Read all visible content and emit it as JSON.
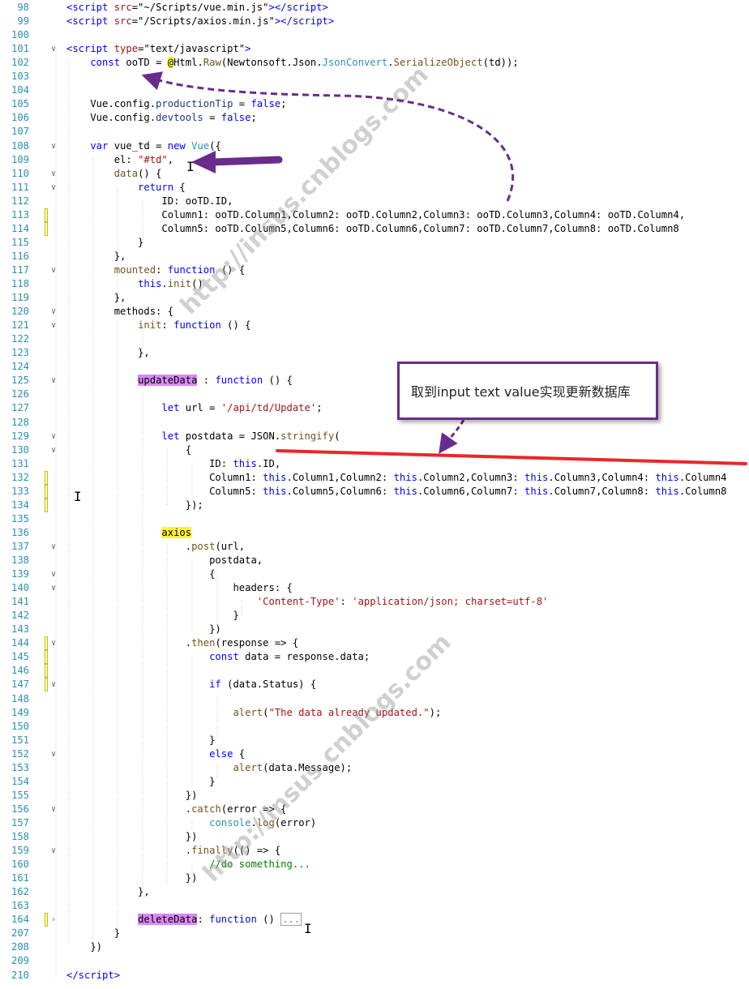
{
  "lines": [
    {
      "n": "98",
      "segs": [
        [
          "<script ",
          "kw"
        ],
        [
          "src",
          "str"
        ],
        [
          "=\"~/Scripts/vue.min.js\"",
          ""
        ],
        [
          "></script>",
          "kw"
        ]
      ]
    },
    {
      "n": "99",
      "segs": [
        [
          "<script ",
          "kw"
        ],
        [
          "src",
          "str"
        ],
        [
          "=\"/Scripts/axios.min.js\"",
          ""
        ],
        [
          "></script>",
          "kw"
        ]
      ]
    },
    {
      "n": "100",
      "segs": []
    },
    {
      "n": "101",
      "segs": [
        [
          "<script ",
          "kw"
        ],
        [
          "type",
          "str"
        ],
        [
          "=\"text/javascript\"",
          ""
        ],
        [
          ">",
          "kw"
        ]
      ]
    },
    {
      "n": "102",
      "segs": [
        [
          "    const ",
          "kw"
        ],
        [
          "ooTD",
          ""
        ],
        [
          " = ",
          ""
        ],
        [
          "@",
          "razor"
        ],
        [
          "Html.",
          ""
        ],
        [
          "Raw",
          "mth"
        ],
        [
          "(Newtonsoft.Json.",
          ""
        ],
        [
          "JsonConvert",
          "typ"
        ],
        [
          ".",
          ""
        ],
        [
          "SerializeObject",
          "mth"
        ],
        [
          "(td));",
          ""
        ]
      ]
    },
    {
      "n": "103",
      "segs": []
    },
    {
      "n": "104",
      "segs": []
    },
    {
      "n": "105",
      "segs": [
        [
          "    Vue.config.",
          ""
        ],
        [
          "productionTip",
          "prop"
        ],
        [
          " = ",
          ""
        ],
        [
          "false",
          "kw"
        ],
        [
          ";",
          ""
        ]
      ]
    },
    {
      "n": "106",
      "segs": [
        [
          "    Vue.config.",
          ""
        ],
        [
          "devtools",
          "prop"
        ],
        [
          " = ",
          ""
        ],
        [
          "false",
          "kw"
        ],
        [
          ";",
          ""
        ]
      ]
    },
    {
      "n": "107",
      "segs": []
    },
    {
      "n": "108",
      "segs": [
        [
          "    var ",
          "kw"
        ],
        [
          "vue_td = ",
          ""
        ],
        [
          "new ",
          "kw"
        ],
        [
          "Vue",
          "typ"
        ],
        [
          "({",
          ""
        ]
      ]
    },
    {
      "n": "109",
      "segs": [
        [
          "        el: ",
          ""
        ],
        [
          "\"#td\"",
          "str"
        ],
        [
          ",",
          ""
        ]
      ]
    },
    {
      "n": "110",
      "segs": [
        [
          "        ",
          ""
        ],
        [
          "data",
          "mth"
        ],
        [
          "() {",
          ""
        ]
      ]
    },
    {
      "n": "111",
      "segs": [
        [
          "            return ",
          "kw"
        ],
        [
          "{",
          ""
        ]
      ]
    },
    {
      "n": "112",
      "segs": [
        [
          "                ID: ooTD.ID,",
          ""
        ]
      ]
    },
    {
      "n": "113",
      "segs": [
        [
          "                Column1: ooTD.Column1,Column2: ooTD.Column2,Column3: ooTD.Column3,Column4: ooTD.Column4,",
          ""
        ]
      ]
    },
    {
      "n": "114",
      "segs": [
        [
          "                Column5: ooTD.Column5,Column6: ooTD.Column6,Column7: ooTD.Column7,Column8: ooTD.Column8",
          ""
        ]
      ]
    },
    {
      "n": "115",
      "segs": [
        [
          "            }",
          ""
        ]
      ]
    },
    {
      "n": "116",
      "segs": [
        [
          "        },",
          ""
        ]
      ]
    },
    {
      "n": "117",
      "segs": [
        [
          "        ",
          ""
        ],
        [
          "mounted",
          "mth"
        ],
        [
          ": ",
          ""
        ],
        [
          "function ",
          "kw"
        ],
        [
          "() {",
          ""
        ]
      ]
    },
    {
      "n": "118",
      "segs": [
        [
          "            ",
          ""
        ],
        [
          "this",
          "kw"
        ],
        [
          ".",
          ""
        ],
        [
          "init",
          "mth"
        ],
        [
          "()",
          ""
        ]
      ]
    },
    {
      "n": "119",
      "segs": [
        [
          "        },",
          ""
        ]
      ]
    },
    {
      "n": "120",
      "segs": [
        [
          "        methods: {",
          ""
        ]
      ]
    },
    {
      "n": "121",
      "segs": [
        [
          "            ",
          ""
        ],
        [
          "init",
          "mth"
        ],
        [
          ": ",
          ""
        ],
        [
          "function ",
          "kw"
        ],
        [
          "() {",
          ""
        ]
      ]
    },
    {
      "n": "122",
      "segs": []
    },
    {
      "n": "123",
      "segs": [
        [
          "            },",
          ""
        ]
      ]
    },
    {
      "n": "124",
      "segs": []
    },
    {
      "n": "125",
      "segs": [
        [
          "            ",
          ""
        ],
        [
          "updateData",
          "hl-purple"
        ],
        [
          " : ",
          ""
        ],
        [
          "function ",
          "kw"
        ],
        [
          "() {",
          ""
        ]
      ]
    },
    {
      "n": "126",
      "segs": []
    },
    {
      "n": "127",
      "segs": [
        [
          "                let ",
          "kw"
        ],
        [
          "url = ",
          ""
        ],
        [
          "'/api/td/Update'",
          "str"
        ],
        [
          ";",
          ""
        ]
      ]
    },
    {
      "n": "128",
      "segs": []
    },
    {
      "n": "129",
      "segs": [
        [
          "                let ",
          "kw"
        ],
        [
          "postdata = JSON.",
          ""
        ],
        [
          "stringify",
          "mth"
        ],
        [
          "(",
          ""
        ]
      ]
    },
    {
      "n": "130",
      "segs": [
        [
          "                    {",
          ""
        ]
      ]
    },
    {
      "n": "131",
      "segs": [
        [
          "                        ID: ",
          ""
        ],
        [
          "this",
          "kw"
        ],
        [
          ".ID,",
          ""
        ]
      ]
    },
    {
      "n": "132",
      "segs": [
        [
          "                        Column1: ",
          ""
        ],
        [
          "this",
          "kw"
        ],
        [
          ".Column1,Column2: ",
          ""
        ],
        [
          "this",
          "kw"
        ],
        [
          ".Column2,Column3: ",
          ""
        ],
        [
          "this",
          "kw"
        ],
        [
          ".Column3,Column4: ",
          ""
        ],
        [
          "this",
          "kw"
        ],
        [
          ".Column4",
          ""
        ]
      ]
    },
    {
      "n": "133",
      "segs": [
        [
          "                        Column5: ",
          ""
        ],
        [
          "this",
          "kw"
        ],
        [
          ".Column5,Column6: ",
          ""
        ],
        [
          "this",
          "kw"
        ],
        [
          ".Column6,Column7: ",
          ""
        ],
        [
          "this",
          "kw"
        ],
        [
          ".Column7,Column8: ",
          ""
        ],
        [
          "this",
          "kw"
        ],
        [
          ".Column8",
          ""
        ]
      ]
    },
    {
      "n": "134",
      "segs": [
        [
          "                    });",
          ""
        ]
      ]
    },
    {
      "n": "135",
      "segs": []
    },
    {
      "n": "136",
      "segs": [
        [
          "                ",
          ""
        ],
        [
          "axios",
          "hl-yellow"
        ]
      ]
    },
    {
      "n": "137",
      "segs": [
        [
          "                    .",
          ""
        ],
        [
          "post",
          "mth"
        ],
        [
          "(url,",
          ""
        ]
      ]
    },
    {
      "n": "138",
      "segs": [
        [
          "                        postdata,",
          ""
        ]
      ]
    },
    {
      "n": "139",
      "segs": [
        [
          "                        {",
          ""
        ]
      ]
    },
    {
      "n": "140",
      "segs": [
        [
          "                            headers: {",
          ""
        ]
      ]
    },
    {
      "n": "141",
      "segs": [
        [
          "                                ",
          ""
        ],
        [
          "'Content-Type'",
          "str"
        ],
        [
          ": ",
          ""
        ],
        [
          "'application/json; charset=utf-8'",
          "str"
        ]
      ]
    },
    {
      "n": "142",
      "segs": [
        [
          "                            }",
          ""
        ]
      ]
    },
    {
      "n": "143",
      "segs": [
        [
          "                        })",
          ""
        ]
      ]
    },
    {
      "n": "144",
      "segs": [
        [
          "                    .",
          ""
        ],
        [
          "then",
          "mth"
        ],
        [
          "(response => {",
          ""
        ]
      ]
    },
    {
      "n": "145",
      "segs": [
        [
          "                        const ",
          "kw"
        ],
        [
          "data = response.data;",
          ""
        ]
      ]
    },
    {
      "n": "146",
      "segs": []
    },
    {
      "n": "147",
      "segs": [
        [
          "                        if ",
          "kw"
        ],
        [
          "(data.Status) {",
          ""
        ]
      ]
    },
    {
      "n": "148",
      "segs": []
    },
    {
      "n": "149",
      "segs": [
        [
          "                            ",
          ""
        ],
        [
          "alert",
          "mth"
        ],
        [
          "(",
          ""
        ],
        [
          "\"The data already updated.\"",
          "str"
        ],
        [
          ");",
          ""
        ]
      ]
    },
    {
      "n": "150",
      "segs": []
    },
    {
      "n": "151",
      "segs": [
        [
          "                        }",
          ""
        ]
      ]
    },
    {
      "n": "152",
      "segs": [
        [
          "                        else ",
          "kw"
        ],
        [
          "{",
          ""
        ]
      ]
    },
    {
      "n": "153",
      "segs": [
        [
          "                            ",
          ""
        ],
        [
          "alert",
          "mth"
        ],
        [
          "(data.Message);",
          ""
        ]
      ]
    },
    {
      "n": "154",
      "segs": [
        [
          "                        }",
          ""
        ]
      ]
    },
    {
      "n": "155",
      "segs": [
        [
          "                    })",
          ""
        ]
      ]
    },
    {
      "n": "156",
      "segs": [
        [
          "                    .",
          ""
        ],
        [
          "catch",
          "mth"
        ],
        [
          "(error => {",
          ""
        ]
      ]
    },
    {
      "n": "157",
      "segs": [
        [
          "                        ",
          ""
        ],
        [
          "console",
          "typ"
        ],
        [
          ".",
          ""
        ],
        [
          "log",
          "mth"
        ],
        [
          "(error)",
          ""
        ]
      ]
    },
    {
      "n": "158",
      "segs": [
        [
          "                    })",
          ""
        ]
      ]
    },
    {
      "n": "159",
      "segs": [
        [
          "                    .",
          ""
        ],
        [
          "finally",
          "mth"
        ],
        [
          "(() => {",
          ""
        ]
      ]
    },
    {
      "n": "160",
      "segs": [
        [
          "                        ",
          ""
        ],
        [
          "//do something...",
          "cmt"
        ]
      ]
    },
    {
      "n": "161",
      "segs": [
        [
          "                    })",
          ""
        ]
      ]
    },
    {
      "n": "162",
      "segs": [
        [
          "            },",
          ""
        ]
      ]
    },
    {
      "n": "163",
      "segs": []
    },
    {
      "n": "164",
      "segs": [
        [
          "            ",
          ""
        ],
        [
          "deleteData",
          "hl-purple"
        ],
        [
          ": ",
          ""
        ],
        [
          "function ",
          "kw"
        ],
        [
          "() ",
          ""
        ],
        [
          "...",
          "collapsed"
        ]
      ]
    },
    {
      "n": "207",
      "segs": [
        [
          "        }",
          ""
        ]
      ]
    },
    {
      "n": "208",
      "segs": [
        [
          "    })",
          ""
        ]
      ]
    },
    {
      "n": "209",
      "segs": []
    },
    {
      "n": "210",
      "segs": [
        [
          "</script>",
          "kw"
        ]
      ]
    }
  ],
  "callout": {
    "text": "取到input text value实现更新数据库"
  },
  "watermark": {
    "text": "http://insus.cnblogs.com"
  },
  "colors": {
    "arrow": "#6a2c8c",
    "underline": "#e82828"
  }
}
